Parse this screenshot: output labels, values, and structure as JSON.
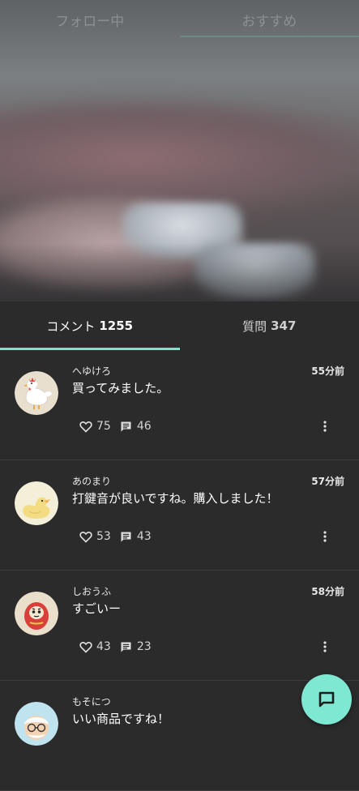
{
  "top_tabs": [
    {
      "label": "フォロー中",
      "active": false
    },
    {
      "label": "おすすめ",
      "active": true
    }
  ],
  "comment_tabs": [
    {
      "label": "コメント",
      "count": "1255",
      "active": true
    },
    {
      "label": "質問",
      "count": "347",
      "active": false
    }
  ],
  "comments": [
    {
      "user": "へゆけろ",
      "time": "55分前",
      "text": "買ってみました。",
      "likes": "75",
      "replies": "46",
      "avatar": "rooster"
    },
    {
      "user": "あのまり",
      "time": "57分前",
      "text": "打鍵音が良いですね。購入しました！",
      "likes": "53",
      "replies": "43",
      "avatar": "duck"
    },
    {
      "user": "しおうふ",
      "time": "58分前",
      "text": "すごいー",
      "likes": "43",
      "replies": "23",
      "avatar": "daruma"
    },
    {
      "user": "もそにつ",
      "time": "",
      "text": "いい商品ですね！",
      "likes": "",
      "replies": "",
      "avatar": "old-man"
    }
  ],
  "icons": {
    "like": "heart-outline-icon",
    "reply": "comment-icon",
    "more": "more-vertical-icon",
    "fab": "chat-icon"
  },
  "colors": {
    "background": "#2b2b2b",
    "accent": "#7fe0cc",
    "fab": "#7fe8d2"
  }
}
